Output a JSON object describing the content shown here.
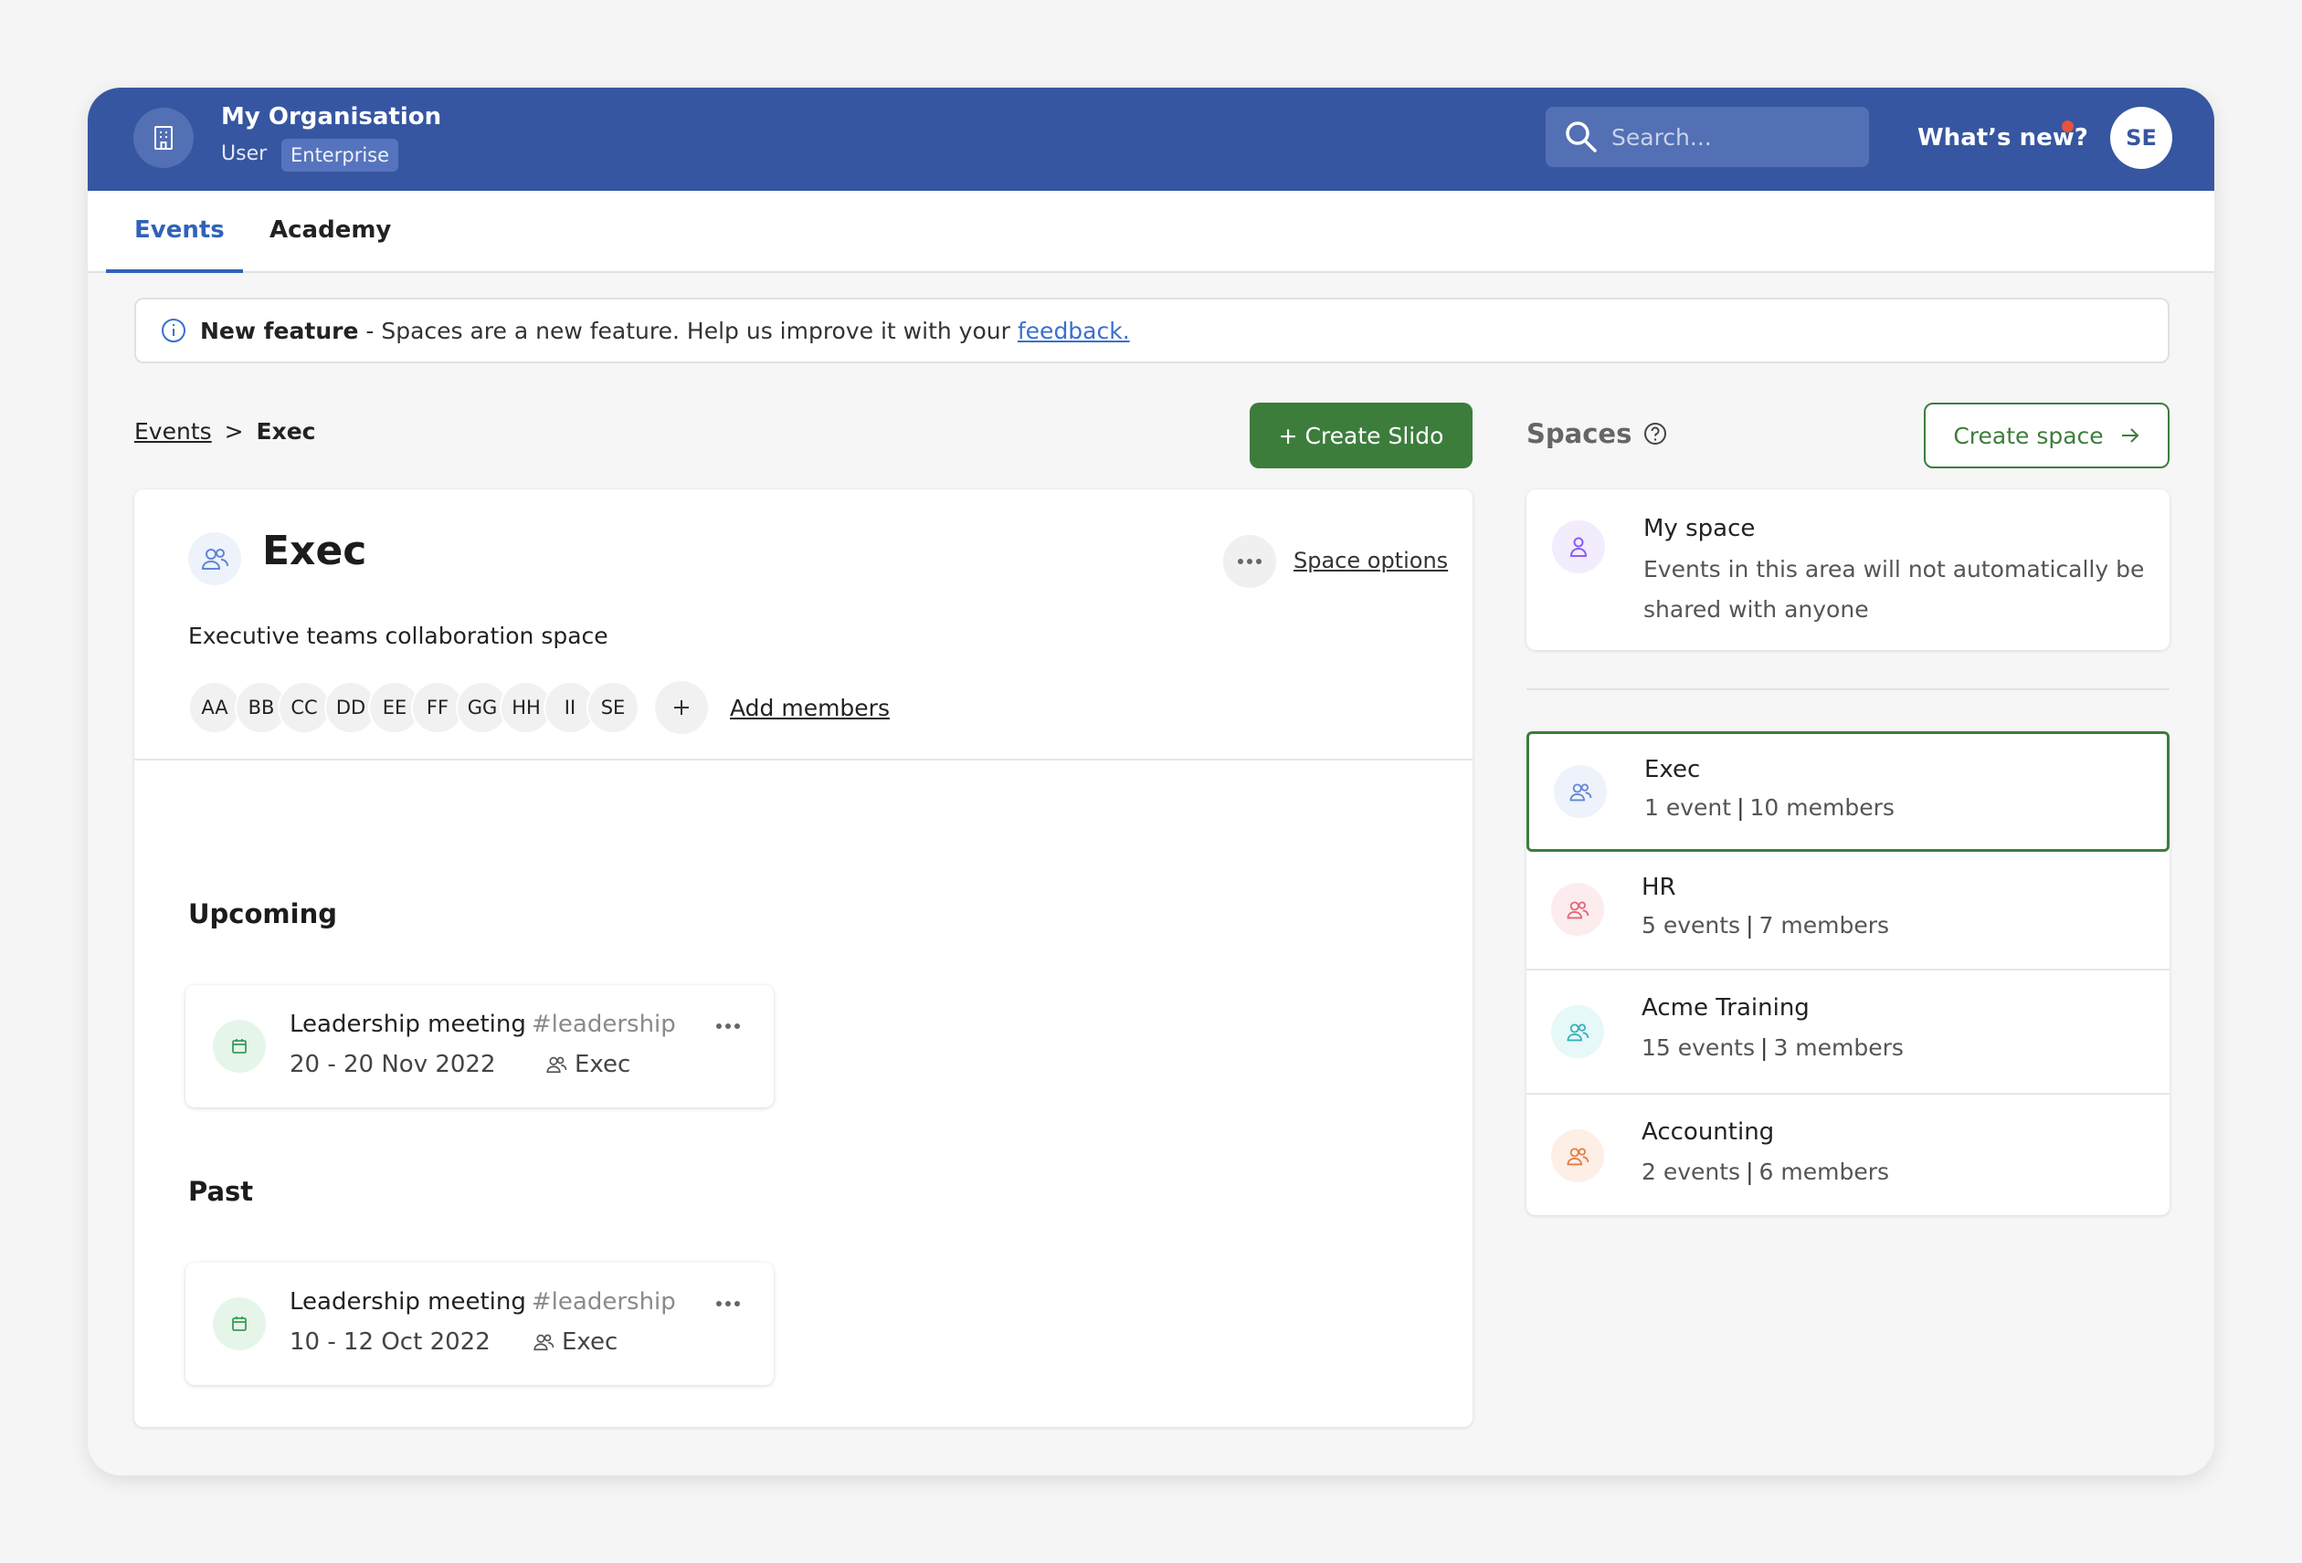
{
  "header": {
    "org_name": "My Organisation",
    "role": "User",
    "plan_badge": "Enterprise",
    "search_placeholder": "Search...",
    "whats_new": "What’s new?",
    "user_initials": "SE"
  },
  "tabs": [
    {
      "label": "Events",
      "active": true
    },
    {
      "label": "Academy",
      "active": false
    }
  ],
  "banner": {
    "bold": "New feature",
    "text": " - Spaces are a new feature. Help us improve it with your",
    "link": "feedback."
  },
  "breadcrumb": {
    "root": "Events",
    "separator": ">",
    "current": "Exec"
  },
  "buttons": {
    "create_slido": "+ Create Slido",
    "create_space": "Create space"
  },
  "space": {
    "title": "Exec",
    "options_label": "Space options",
    "description": "Executive teams collaboration space",
    "members": [
      "AA",
      "BB",
      "CC",
      "DD",
      "EE",
      "FF",
      "GG",
      "HH",
      "II",
      "SE"
    ],
    "add_members_label": "Add members"
  },
  "sections": {
    "upcoming": "Upcoming",
    "past": "Past"
  },
  "upcoming_events": [
    {
      "title": "Leadership meeting",
      "tag": "#leadership",
      "date": "20 - 20 Nov 2022",
      "space": "Exec"
    }
  ],
  "past_events": [
    {
      "title": "Leadership meeting",
      "tag": "#leadership",
      "date": "10 - 12 Oct 2022",
      "space": "Exec"
    }
  ],
  "spaces_panel": {
    "heading": "Spaces",
    "my_space": {
      "title": "My space",
      "description": "Events in this area will not automatically be shared with anyone"
    },
    "list": [
      {
        "name": "Exec",
        "events": "1 event",
        "members": "10 members",
        "selected": true,
        "color": "#5f86d6",
        "bg": "#eef2fa"
      },
      {
        "name": "HR",
        "events": "5 events",
        "members": "7 members",
        "selected": false,
        "color": "#e0667a",
        "bg": "#fdecee"
      },
      {
        "name": "Acme Training",
        "events": "15 events",
        "members": "3 members",
        "selected": false,
        "color": "#37b0b8",
        "bg": "#e6f8f8"
      },
      {
        "name": "Accounting",
        "events": "2 events",
        "members": "6 members",
        "selected": false,
        "color": "#e07d45",
        "bg": "#fdefe6"
      }
    ]
  },
  "colors": {
    "header_bg": "#3656a1",
    "primary_green": "#3d7d3c",
    "active_tab": "#2f63b9",
    "notification": "#e5533d"
  }
}
